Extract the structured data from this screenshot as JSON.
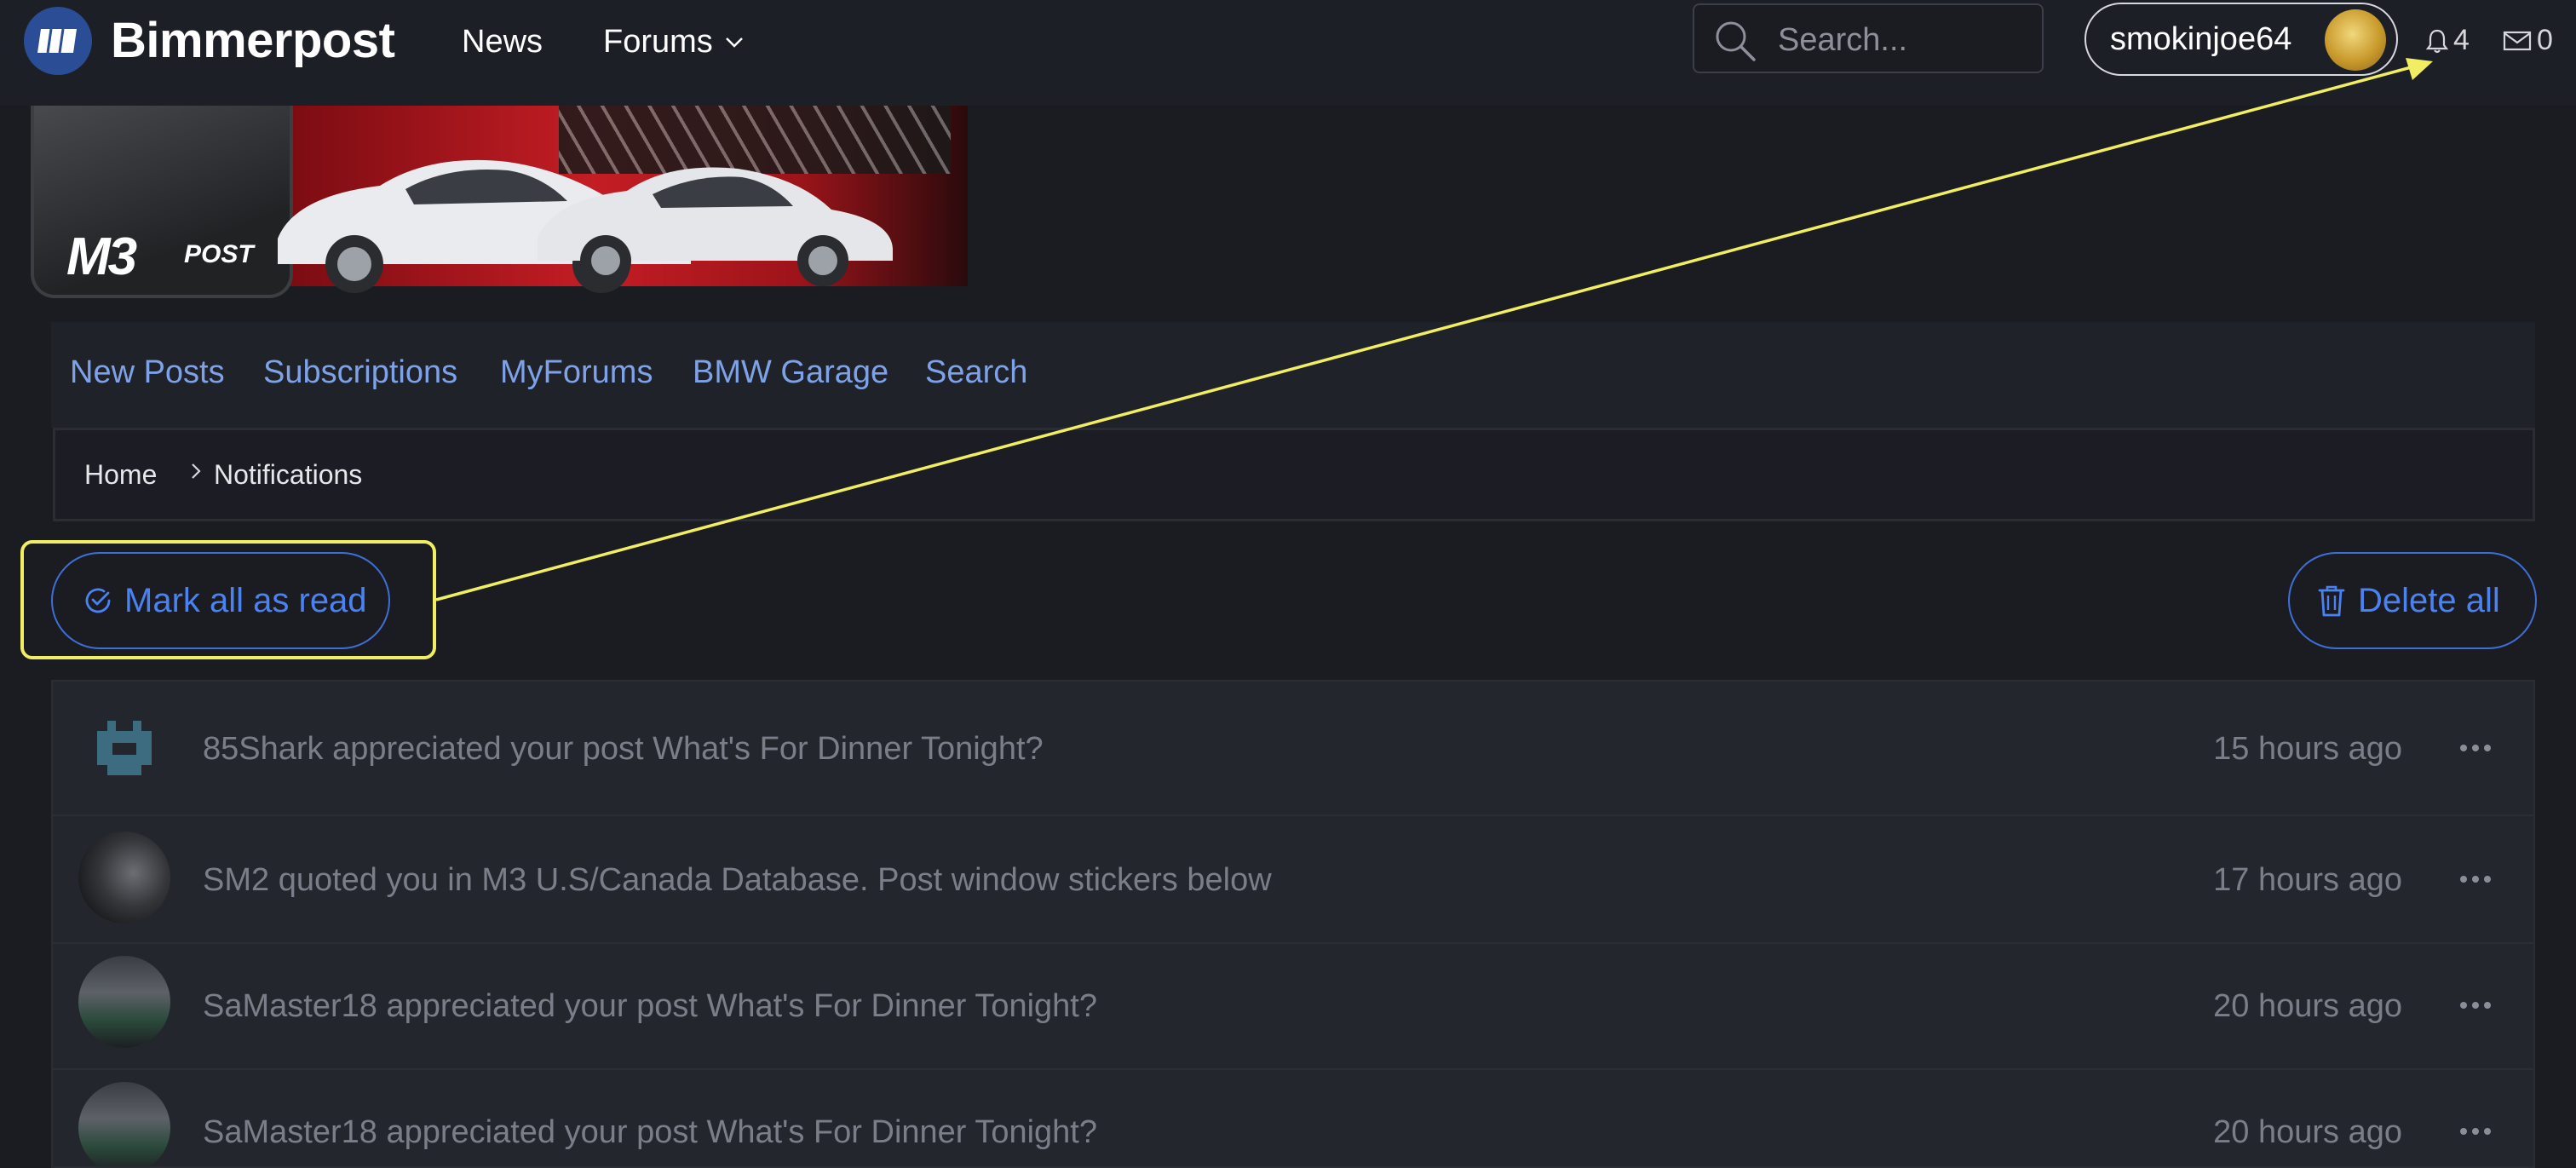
{
  "header": {
    "brand": "Bimmerpost",
    "nav": [
      {
        "label": "News"
      },
      {
        "label": "Forums"
      }
    ],
    "search_placeholder": "Search...",
    "username": "smokinjoe64",
    "alerts_count": "4",
    "messages_count": "0"
  },
  "banner": {
    "logo_text": "M3",
    "logo_suffix": "POST"
  },
  "subnav": [
    "New Posts",
    "Subscriptions",
    "MyForums",
    "BMW Garage",
    "Search"
  ],
  "breadcrumb": {
    "home": "Home",
    "current": "Notifications"
  },
  "actions": {
    "mark_all": "Mark all as read",
    "delete_all": "Delete all"
  },
  "notifications": [
    {
      "text": "85Shark appreciated your post What's For Dinner Tonight?",
      "time": "15 hours ago",
      "avatar": "pixel-avatar"
    },
    {
      "text": "SM2 quoted you in M3 U.S/Canada Database. Post window stickers below",
      "time": "17 hours ago",
      "avatar": "helmet-avatar"
    },
    {
      "text": "SaMaster18 appreciated your post What's For Dinner Tonight?",
      "time": "20 hours ago",
      "avatar": "car-avatar"
    },
    {
      "text": "SaMaster18 appreciated your post What's For Dinner Tonight?",
      "time": "20 hours ago",
      "avatar": "car-avatar"
    }
  ],
  "colors": {
    "accent": "#4a82f2",
    "link": "#7ea2e8",
    "highlight": "#f1ee62",
    "background": "#1b1c22"
  }
}
